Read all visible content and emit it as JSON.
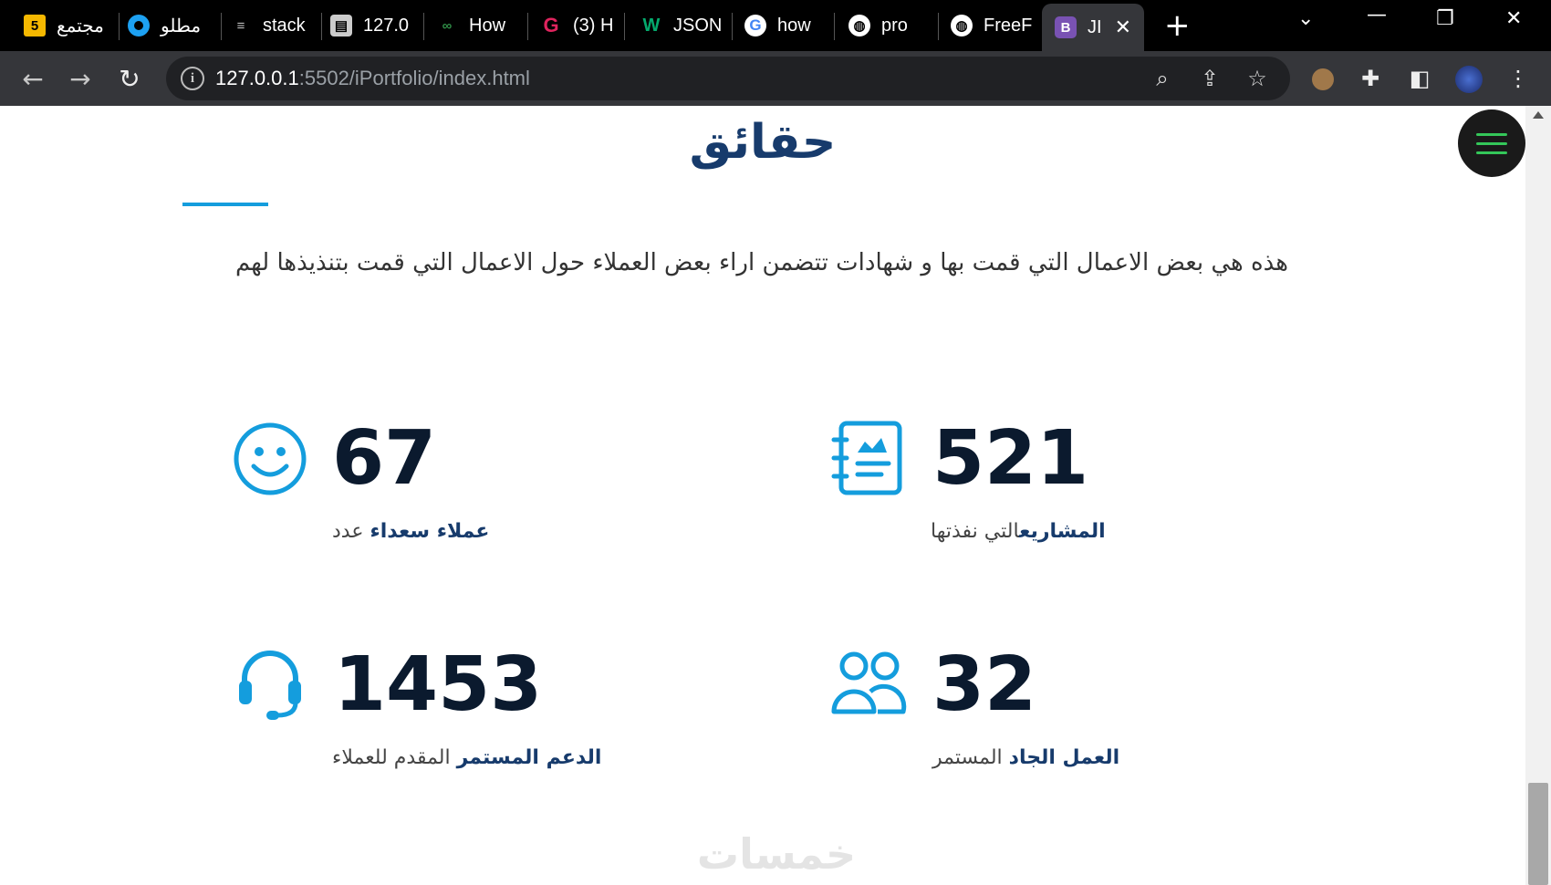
{
  "browser": {
    "tabs": [
      {
        "label": "مجتمع",
        "icon": "hsoub-icon"
      },
      {
        "label": "مطلو",
        "icon": "circle-icon"
      },
      {
        "label": "stack",
        "icon": "stackoverflow-icon"
      },
      {
        "label": "127.0",
        "icon": "bus-icon"
      },
      {
        "label": "How",
        "icon": "geeksforgeeks-icon"
      },
      {
        "label": "(3) H",
        "icon": "c-icon"
      },
      {
        "label": "JSON",
        "icon": "w3schools-icon"
      },
      {
        "label": "how",
        "icon": "google-icon"
      },
      {
        "label": "pro",
        "icon": "globe-icon"
      },
      {
        "label": "FreeF",
        "icon": "globe-icon"
      },
      {
        "label": "JI",
        "icon": "bootstrap-icon"
      }
    ],
    "url_host": "127.0.0.1",
    "url_rest": ":5502/iPortfolio/index.html"
  },
  "section": {
    "title": "حقائق",
    "description": "هذه هي بعض الاعمال التي قمت بها و شهادات تتضمن اراء بعض العملاء حول الاعمال التي قمت بتنذيذها لهم"
  },
  "facts": [
    {
      "number": "67",
      "label_bold": "عملاء سعداء",
      "label_rest": "عدد",
      "icon": "smiley-icon"
    },
    {
      "number": "521",
      "label_bold": "المشاريع",
      "label_rest": "التي نفذتها",
      "icon": "journal-icon"
    },
    {
      "number": "1453",
      "label_bold": "الدعم المستمر",
      "label_rest": "المقدم للعملاء",
      "icon": "headset-icon"
    },
    {
      "number": "32",
      "label_bold": "العمل الجاد",
      "label_rest": "المستمر",
      "icon": "people-icon"
    }
  ],
  "watermark": "خمسات",
  "colors": {
    "accent": "#149ddd",
    "heading": "#173b6c",
    "menu": "#34c759"
  }
}
